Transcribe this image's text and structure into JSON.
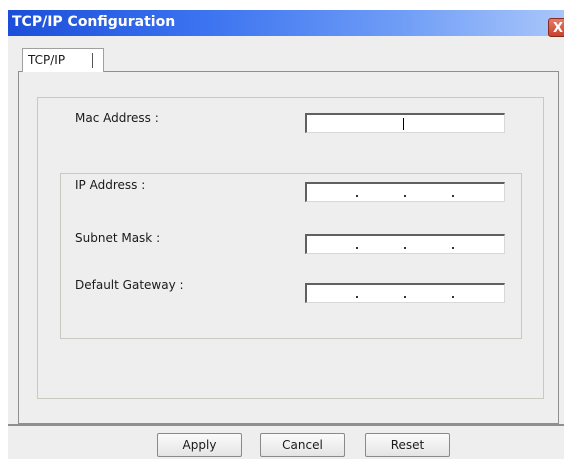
{
  "window": {
    "title": "TCP/IP Configuration",
    "close_label": "X"
  },
  "tabs": [
    {
      "label": "TCP/IP",
      "active": true
    }
  ],
  "form": {
    "mac_address": {
      "label": "Mac Address :",
      "value": ""
    },
    "ip_address": {
      "label": "IP Address :",
      "value": ". . ."
    },
    "subnet_mask": {
      "label": "Subnet Mask :",
      "value": ". . ."
    },
    "default_gateway": {
      "label": "Default Gateway :",
      "value": ". . ."
    }
  },
  "buttons": {
    "apply": "Apply",
    "cancel": "Cancel",
    "reset": "Reset"
  },
  "colors": {
    "titlebar_start": "#1c4fd9",
    "titlebar_end": "#a9c6fa",
    "close_button": "#c9422c",
    "dialog_background": "#eeeeee"
  }
}
